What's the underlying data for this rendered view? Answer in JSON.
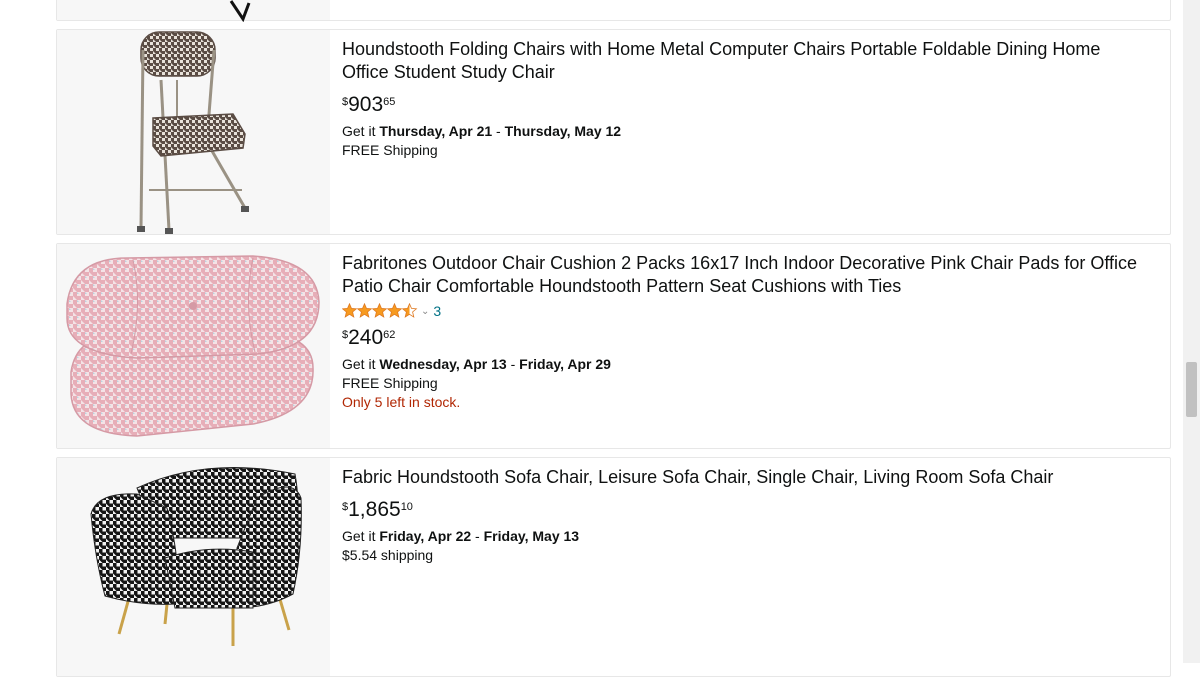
{
  "products": [
    {
      "title": "Houndstooth Folding Chairs with Home Metal Computer Chairs Portable Foldable Dining Home Office Student Study Chair",
      "price_symbol": "$",
      "price_whole": "903",
      "price_fraction": "65",
      "delivery_prefix": "Get it ",
      "delivery_start": "Thursday, Apr 21",
      "delivery_sep": " - ",
      "delivery_end": "Thursday, May 12",
      "shipping": "FREE Shipping",
      "image_icon": "folding-chair-image"
    },
    {
      "title": "Fabritones Outdoor Chair Cushion 2 Packs 16x17 Inch Indoor Decorative Pink Chair Pads for Office Patio Chair Comfortable Houndstooth Pattern Seat Cushions with Ties",
      "rating_stars": 4.5,
      "rating_count": "3",
      "price_symbol": "$",
      "price_whole": "240",
      "price_fraction": "62",
      "delivery_prefix": "Get it ",
      "delivery_start": "Wednesday, Apr 13",
      "delivery_sep": " - ",
      "delivery_end": "Friday, Apr 29",
      "shipping": "FREE Shipping",
      "stock_note": "Only 5 left in stock.",
      "image_icon": "chair-cushions-image"
    },
    {
      "title": "Fabric Houndstooth Sofa Chair, Leisure Sofa Chair, Single Chair, Living Room Sofa Chair",
      "price_symbol": "$",
      "price_whole": "1,865",
      "price_fraction": "10",
      "delivery_prefix": "Get it ",
      "delivery_start": "Friday, Apr 22",
      "delivery_sep": " - ",
      "delivery_end": "Friday, May 13",
      "shipping": "$5.54 shipping",
      "image_icon": "sofa-chair-image"
    }
  ],
  "colors": {
    "star": "#F79A1F",
    "link": "#007185",
    "stock_warning": "#B12704",
    "text": "#0F1111"
  }
}
